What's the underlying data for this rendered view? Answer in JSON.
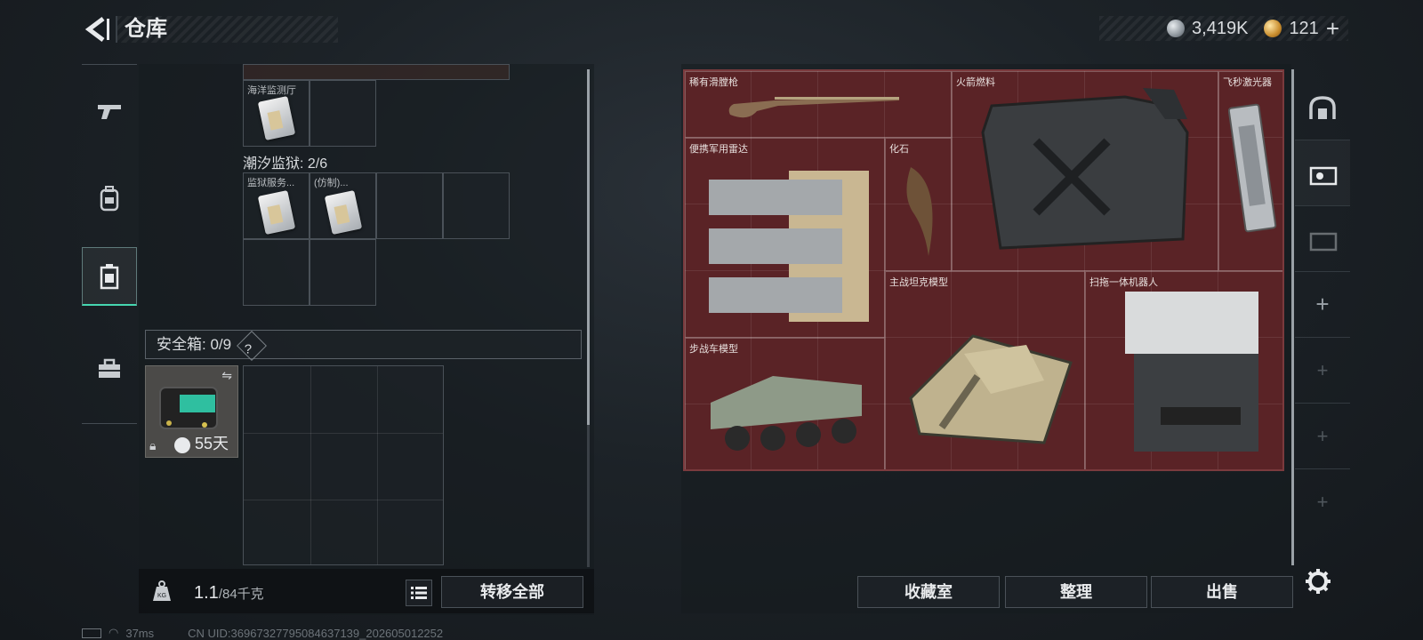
{
  "header": {
    "title": "仓库",
    "currency_silver": "3,419K",
    "currency_gold": "121",
    "plus_glyph": "+"
  },
  "left_rail": {
    "items": [
      "gun-icon",
      "backpack-icon",
      "container-icon",
      "toolbox-icon"
    ],
    "active_index": 2
  },
  "left_panel": {
    "top_group_cell_label": "海洋监测厅",
    "group2_title": "潮汐监狱: 2/6",
    "group2_cells": [
      "监狱服务...",
      "(仿制)..."
    ],
    "safe_box": {
      "label": "安全箱: 0/9",
      "help": "?",
      "timer": "55天"
    }
  },
  "footer_left": {
    "weight_value": "1.1",
    "weight_max": "/84千克",
    "transfer_all": "转移全部",
    "kg_badge": "KG"
  },
  "collection": {
    "items": [
      {
        "label": "稀有滑膛枪"
      },
      {
        "label": "火箭燃料"
      },
      {
        "label": "飞秒激光器"
      },
      {
        "label": "便携军用雷达"
      },
      {
        "label": "化石"
      },
      {
        "label": "主战坦克模型"
      },
      {
        "label": "扫拖一体机器人"
      },
      {
        "label": "步战车模型"
      }
    ]
  },
  "footer_right": {
    "collection_room": "收藏室",
    "organize": "整理",
    "sell": "出售"
  },
  "status_bar": {
    "ping": "37ms",
    "uid": "CN UID:3696732779508463713​9_202605012252"
  },
  "colors": {
    "accent": "#46d6b0",
    "collection_bg": "#5a2326"
  }
}
